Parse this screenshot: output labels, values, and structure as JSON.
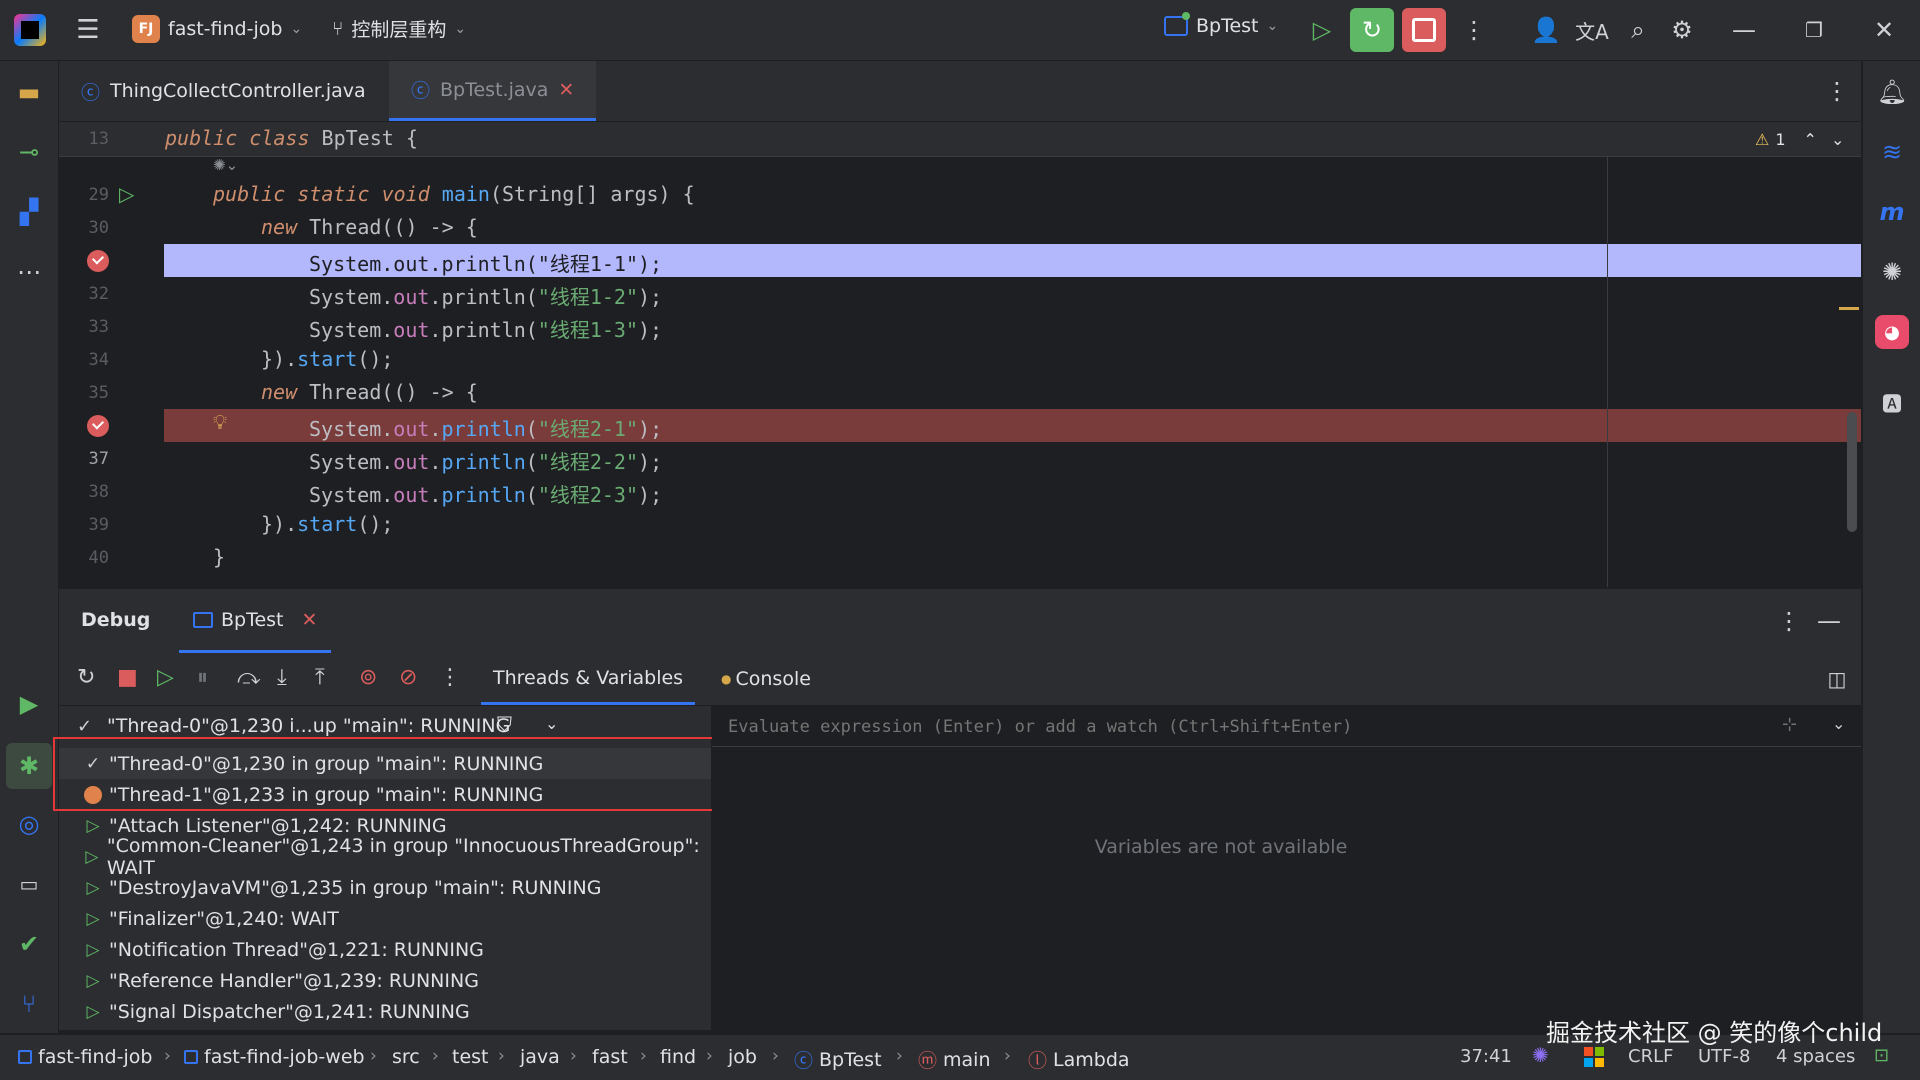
{
  "titlebar": {
    "project_badge": "FJ",
    "project_name": "fast-find-job",
    "branch": "控制层重构",
    "run_config": "BpTest"
  },
  "tabs": [
    {
      "label": "ThingCollectController.java"
    },
    {
      "label": "BpTest.java"
    }
  ],
  "editor": {
    "warning_count": "1",
    "lines": [
      {
        "num": "13"
      },
      {
        "num": "29"
      },
      {
        "num": "30"
      },
      {
        "num": ""
      },
      {
        "num": "32"
      },
      {
        "num": "33"
      },
      {
        "num": "34"
      },
      {
        "num": "35"
      },
      {
        "num": ""
      },
      {
        "num": "37"
      },
      {
        "num": "38"
      },
      {
        "num": "39"
      },
      {
        "num": "40"
      }
    ]
  },
  "debug": {
    "title": "Debug",
    "session_tab": "BpTest",
    "tab_threads": "Threads & Variables",
    "tab_console": "Console",
    "selected_thread": "\"Thread-0\"@1,230 i...up \"main\": RUNNING",
    "eval_placeholder": "Evaluate expression (Enter) or add a watch (Ctrl+Shift+Enter)",
    "variables_message": "Variables are not available",
    "threads": [
      {
        "label": "\"Thread-0\"@1,230 in group \"main\": RUNNING",
        "icon": "check-icon"
      },
      {
        "label": "\"Thread-1\"@1,233 in group \"main\": RUNNING",
        "icon": "breakpoint-dot-icon"
      },
      {
        "label": "\"Attach Listener\"@1,242: RUNNING",
        "icon": "play-icon"
      },
      {
        "label": "\"Common-Cleaner\"@1,243 in group \"InnocuousThreadGroup\": WAIT",
        "icon": "play-icon"
      },
      {
        "label": "\"DestroyJavaVM\"@1,235 in group \"main\": RUNNING",
        "icon": "play-icon"
      },
      {
        "label": "\"Finalizer\"@1,240: WAIT",
        "icon": "play-icon"
      },
      {
        "label": "\"Notification Thread\"@1,221: RUNNING",
        "icon": "play-icon"
      },
      {
        "label": "\"Reference Handler\"@1,239: RUNNING",
        "icon": "play-icon"
      },
      {
        "label": "\"Signal Dispatcher\"@1,241: RUNNING",
        "icon": "play-icon"
      }
    ]
  },
  "statusbar": {
    "breadcrumbs": [
      "fast-find-job",
      "fast-find-job-web",
      "src",
      "test",
      "java",
      "fast",
      "find",
      "job",
      "BpTest",
      "main",
      "Lambda"
    ],
    "position": "37:41",
    "line_separator": "CRLF",
    "encoding": "UTF-8",
    "indent": "4 spaces",
    "watermark": "掘金技术社区 @ 笑的像个child"
  },
  "colors": {
    "accent": "#3574f0",
    "breakpoint": "#db5c5c",
    "current_line": "#b3b7fb",
    "breakpoint_line": "#7a3b3b",
    "highlight_box": "#e53935"
  }
}
